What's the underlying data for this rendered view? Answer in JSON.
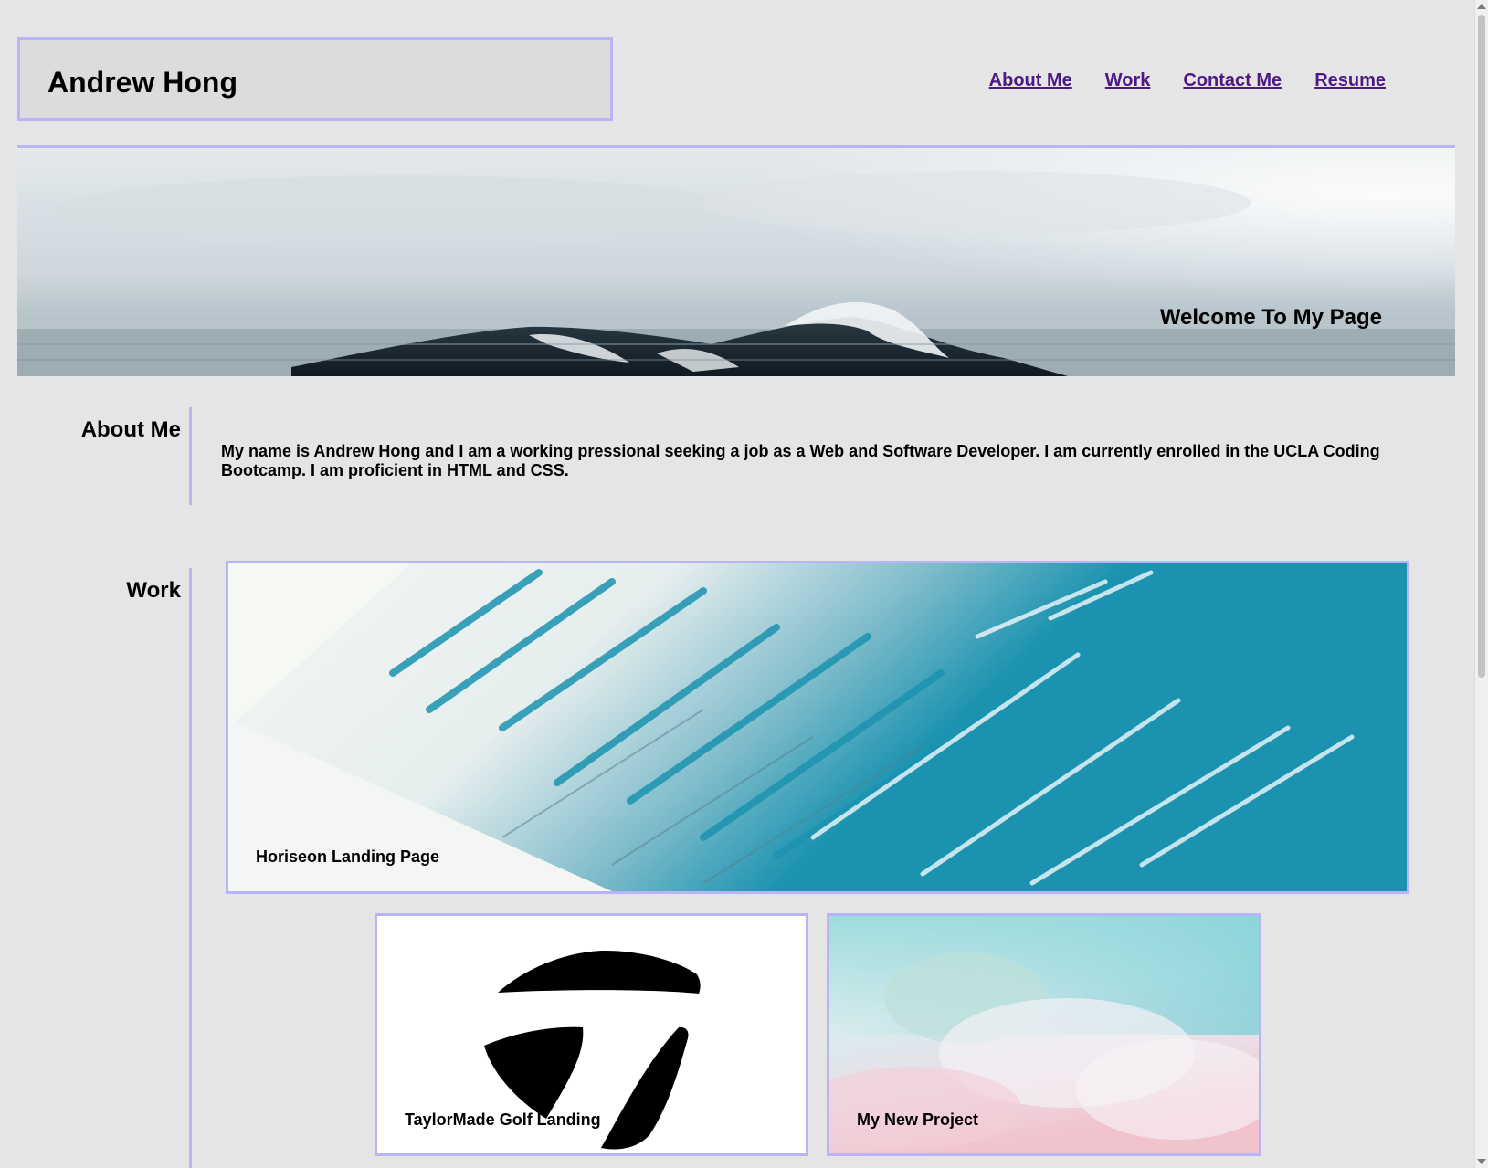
{
  "header": {
    "title": "Andrew Hong",
    "nav": [
      {
        "label": "About Me"
      },
      {
        "label": "Work"
      },
      {
        "label": "Contact Me"
      },
      {
        "label": "Resume"
      }
    ]
  },
  "hero": {
    "tagline": "Welcome To My Page",
    "image": "ocean-wave-image"
  },
  "about": {
    "heading": "About Me",
    "text": "My name is Andrew Hong and I am a working pressional seeking a job as a Web and Software Developer. I am currently enrolled in the UCLA Coding Bootcamp. I am proficient in HTML and CSS."
  },
  "work": {
    "heading": "Work",
    "projects": [
      {
        "label": "Horiseon Landing Page",
        "image": "water-splash-image"
      },
      {
        "label": "TaylorMade Golf Landing",
        "image": "taylormade-logo-image"
      },
      {
        "label": "My New Project",
        "image": "pastel-clouds-image"
      }
    ]
  },
  "colors": {
    "background": "#e5e5e5",
    "border_accent": "#b8b4f5",
    "link": "#4d1a85",
    "splash_blue": "#1b93b0"
  }
}
